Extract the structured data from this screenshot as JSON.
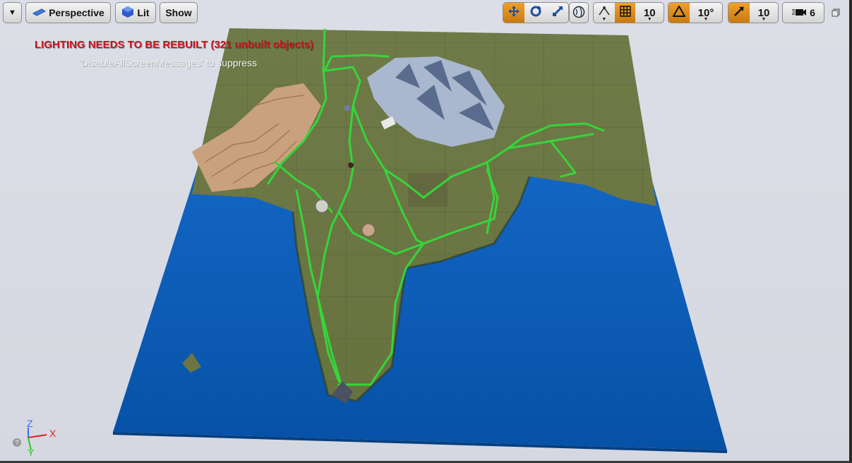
{
  "toolbar": {
    "menu_caret": "▼",
    "view_mode": "Perspective",
    "lighting_mode": "Lit",
    "show_label": "Show",
    "grid_snap_value": "10",
    "rotation_snap_value": "10°",
    "scale_snap_value": "10",
    "camera_speed_value": "6",
    "active_color": "#e39324"
  },
  "messages": {
    "warning": "LIGHTING NEEDS TO BE REBUILT (321 unbuilt objects)",
    "hint": "'DisableAllScreenMessages' to suppress"
  },
  "axis": {
    "z_label": "Z",
    "x_label": "X",
    "y_label": "Y",
    "z_color": "#3b6cf0",
    "x_color": "#e02020",
    "y_color": "#29c829"
  },
  "scene": {
    "ocean_color": "#0a5cb6",
    "land_color": "#707a45",
    "route_color": "#34d63a"
  }
}
